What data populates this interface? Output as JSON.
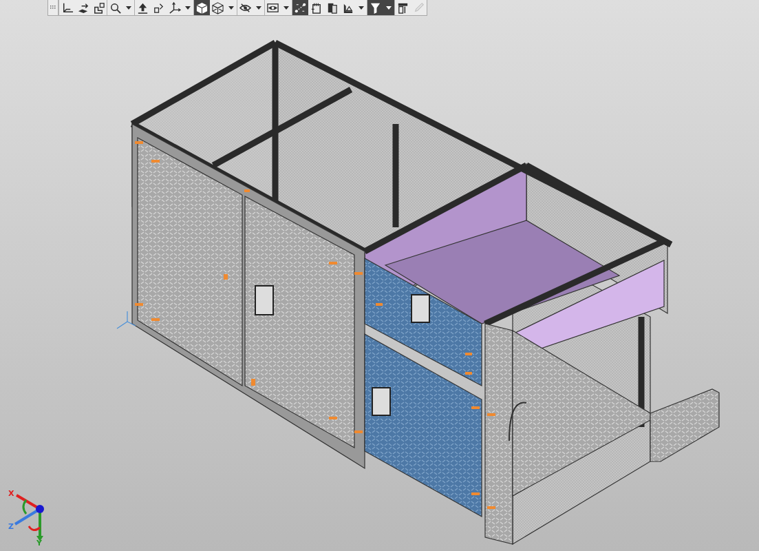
{
  "toolbar": {
    "groups": [
      [
        {
          "dropdown": false,
          "selected": false,
          "disabled": false
        },
        {
          "dropdown": false,
          "selected": false,
          "disabled": false
        },
        {
          "dropdown": false,
          "selected": false,
          "disabled": false
        }
      ],
      [
        {
          "dropdown": true,
          "selected": false,
          "disabled": false
        }
      ],
      [
        {
          "dropdown": false,
          "selected": false,
          "disabled": false
        },
        {
          "dropdown": false,
          "selected": false,
          "disabled": false
        },
        {
          "dropdown": true,
          "selected": false,
          "disabled": false
        }
      ],
      [
        {
          "dropdown": false,
          "selected": true,
          "disabled": false
        },
        {
          "dropdown": true,
          "selected": false,
          "disabled": false
        }
      ],
      [
        {
          "dropdown": true,
          "selected": false,
          "disabled": false
        }
      ],
      [
        {
          "dropdown": true,
          "selected": false,
          "disabled": false
        }
      ],
      [
        {
          "dropdown": false,
          "selected": true,
          "disabled": false
        },
        {
          "dropdown": false,
          "selected": false,
          "disabled": false
        },
        {
          "dropdown": false,
          "selected": false,
          "disabled": false
        },
        {
          "dropdown": true,
          "selected": false,
          "disabled": false
        }
      ],
      [
        {
          "dropdown": true,
          "selected": true,
          "disabled": false
        }
      ],
      [
        {
          "dropdown": false,
          "selected": false,
          "disabled": false
        },
        {
          "dropdown": false,
          "selected": false,
          "disabled": true
        }
      ]
    ]
  },
  "axis_triad": {
    "x_label": "X",
    "y_label": "Y",
    "z_label": "Z"
  }
}
